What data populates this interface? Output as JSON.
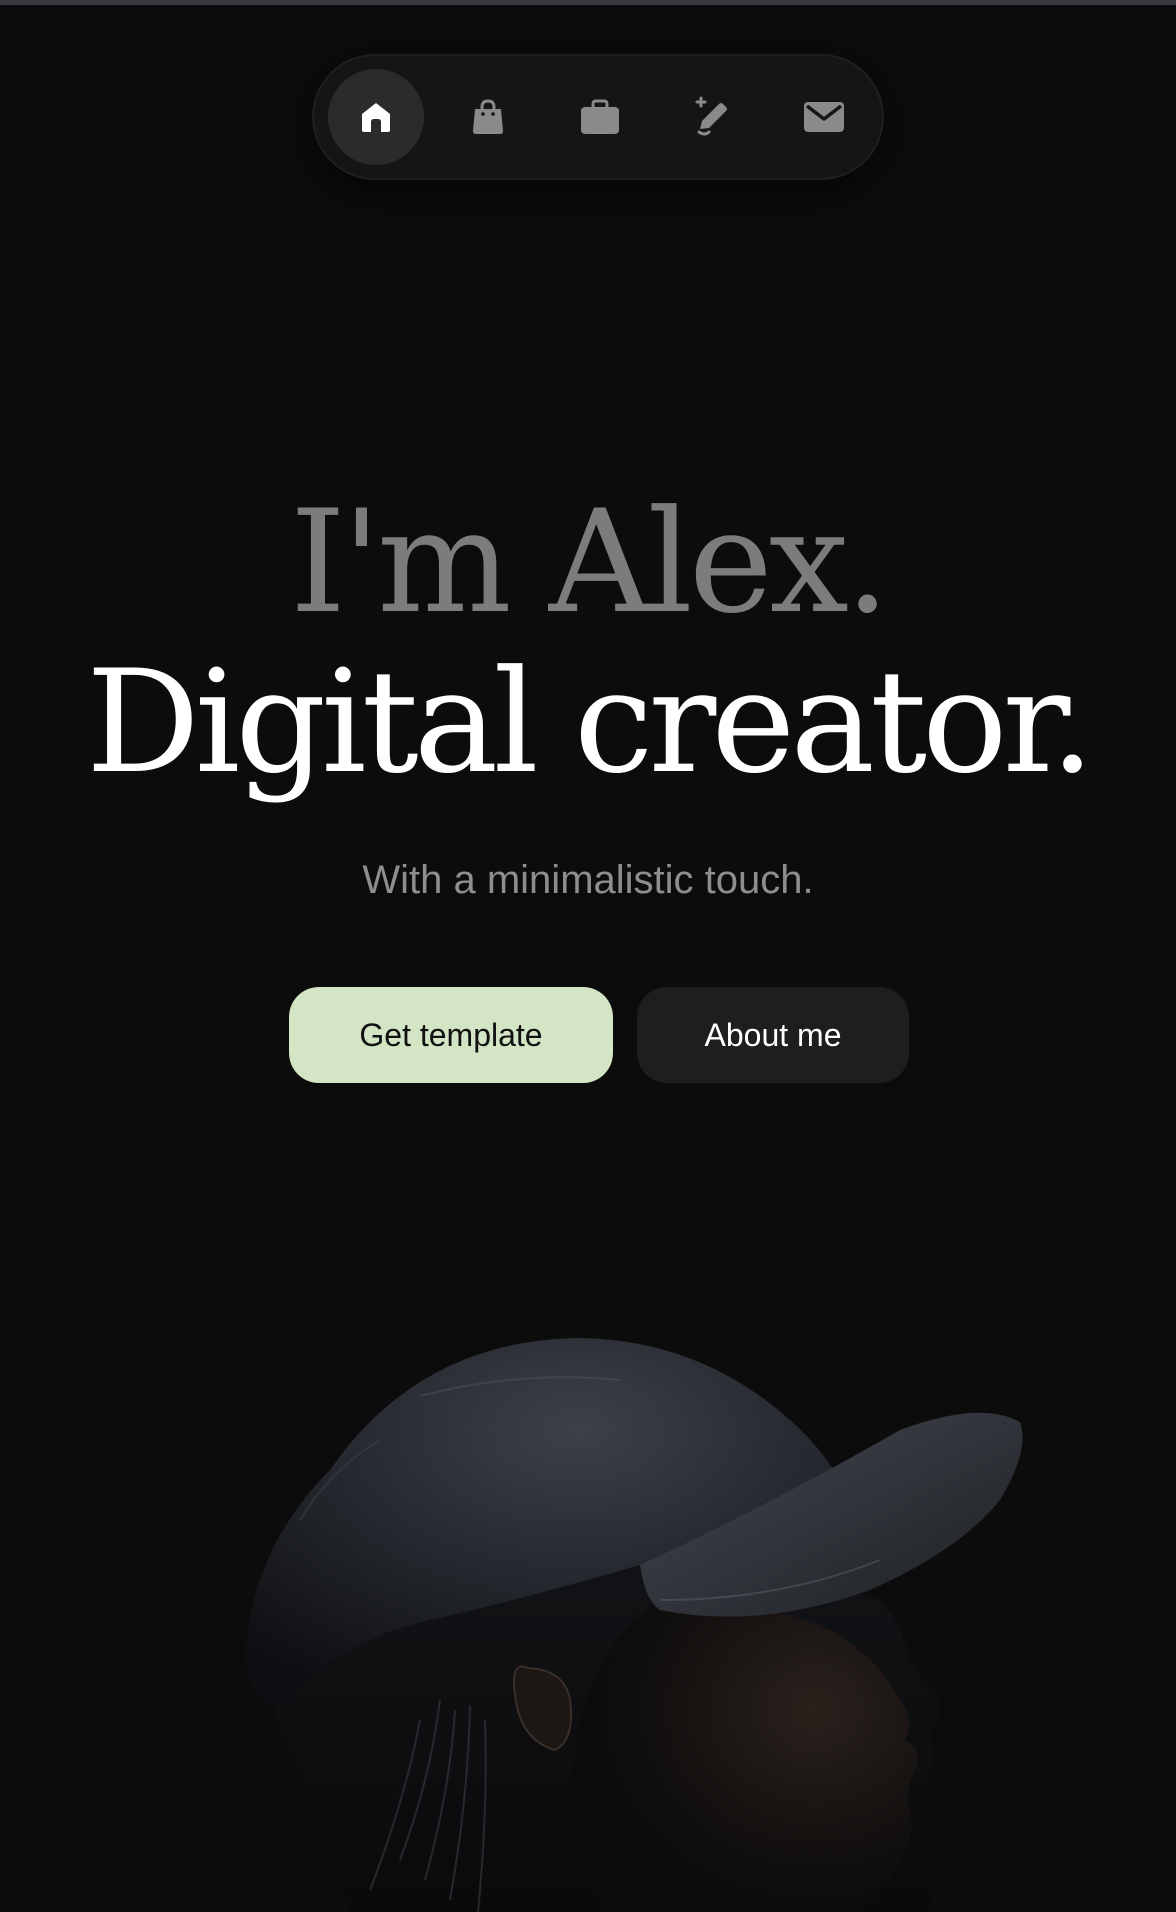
{
  "nav": {
    "items": [
      {
        "icon": "home-icon",
        "active": true
      },
      {
        "icon": "shopping-bag-icon",
        "active": false
      },
      {
        "icon": "briefcase-icon",
        "active": false
      },
      {
        "icon": "pen-icon",
        "active": false
      },
      {
        "icon": "mail-icon",
        "active": false
      }
    ]
  },
  "hero": {
    "intro": "I'm Alex.",
    "headline": "Digital creator.",
    "subtitle": "With a minimalistic touch."
  },
  "buttons": {
    "primary_label": "Get template",
    "secondary_label": "About me"
  },
  "colors": {
    "background": "#0c0c0c",
    "accent": "#d3e5c5",
    "muted_text": "#7c7c7c"
  }
}
